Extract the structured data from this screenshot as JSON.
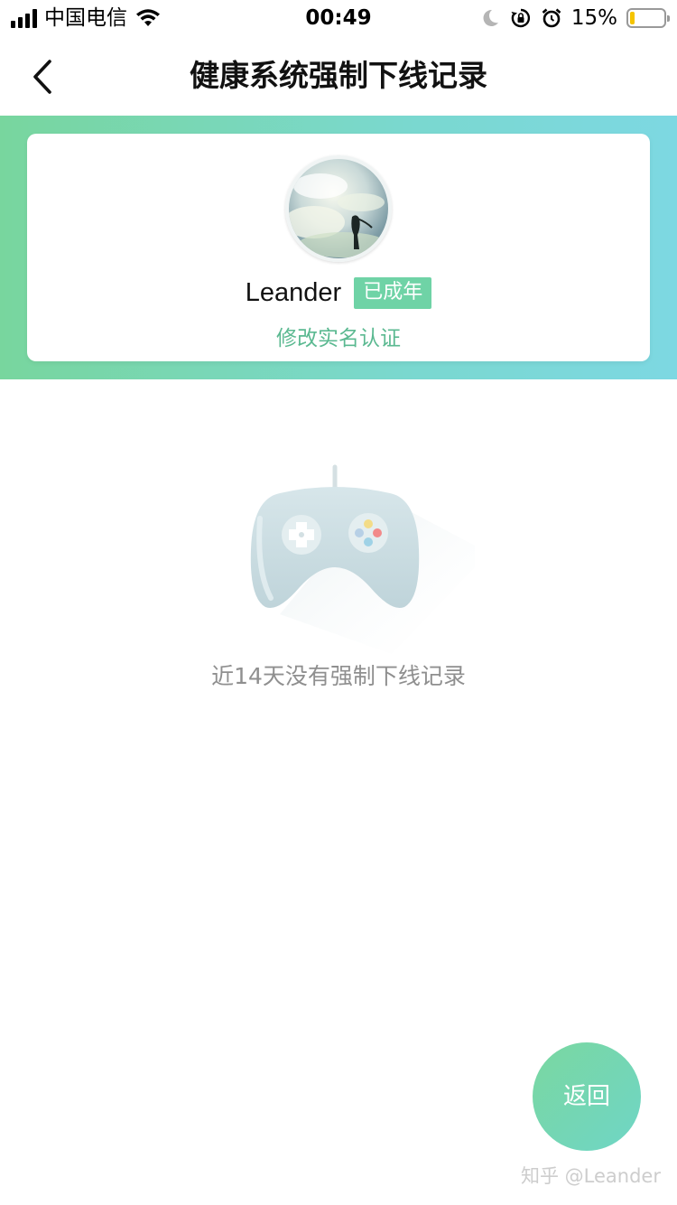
{
  "status_bar": {
    "carrier": "中国电信",
    "time": "00:49",
    "battery_percent": "15%",
    "battery_level": 0.15,
    "icons": [
      "signal-icon",
      "wifi-icon",
      "moon-icon",
      "rotation-lock-icon",
      "alarm-icon",
      "battery-icon"
    ]
  },
  "nav": {
    "title": "健康系统强制下线记录",
    "back_icon": "chevron-left-icon"
  },
  "profile": {
    "name": "Leander",
    "badge": "已成年",
    "verify_link": "修改实名认证"
  },
  "empty_state": {
    "icon": "gamepad-icon",
    "message": "近14天没有强制下线记录"
  },
  "return_button": {
    "label": "返回"
  },
  "watermark": "知乎 @Leander",
  "colors": {
    "gradient_start": "#78d69e",
    "gradient_end": "#7dd8e2",
    "accent_green": "#5bb991",
    "badge_bg": "#6fd3a6"
  }
}
